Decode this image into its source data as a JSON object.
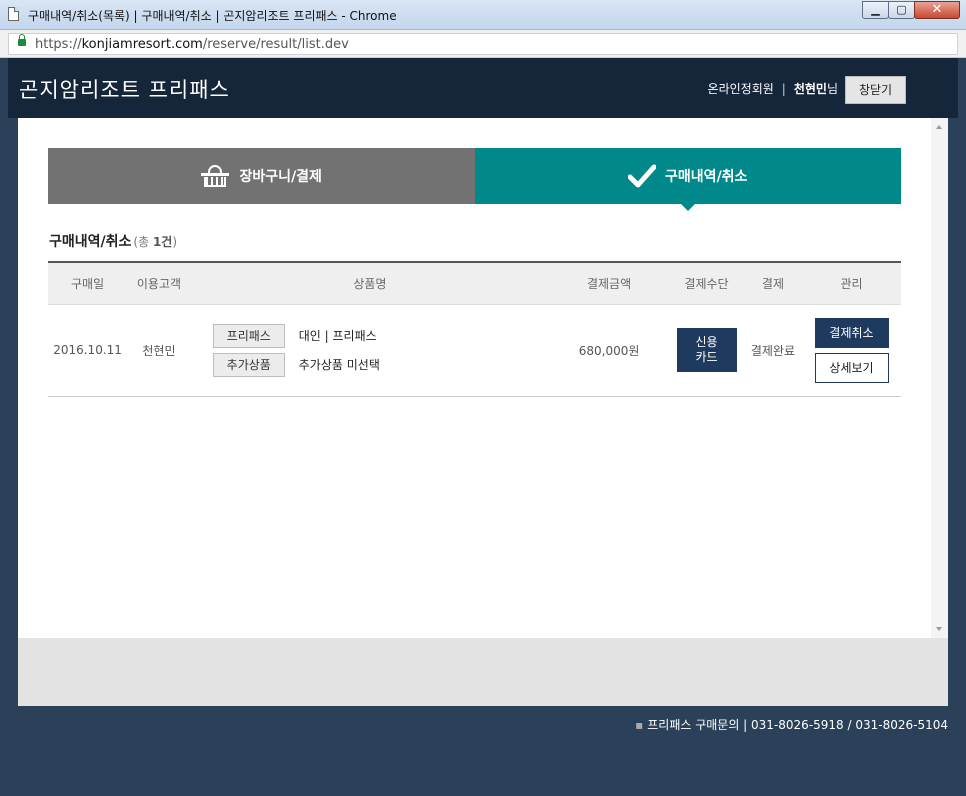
{
  "window": {
    "title": "구매내역/취소(목록) | 구매내역/취소 | 곤지암리조트 프리패스 - Chrome",
    "url_scheme": "https://",
    "url_host": "konjiamresort.com",
    "url_path": "/reserve/result/list.dev"
  },
  "header": {
    "site_title": "곤지암리조트 프리패스",
    "member_type": "온라인정회원",
    "user_name": "천현민",
    "user_suffix": "님",
    "close_label": "창닫기"
  },
  "tabs": [
    {
      "label": "장바구니/결제",
      "icon": "basket-icon",
      "active": false,
      "color": "#727272"
    },
    {
      "label": "구매내역/취소",
      "icon": "check-icon",
      "active": true,
      "color": "#00888a"
    }
  ],
  "section": {
    "title": "구매내역/취소",
    "count_prefix": "(총 ",
    "count_value": "1건",
    "count_suffix": ")"
  },
  "table": {
    "columns": [
      "구매일",
      "이용고객",
      "상품명",
      "결제금액",
      "결제수단",
      "결제",
      "관리"
    ],
    "rows": [
      {
        "date": "2016.10.11",
        "customer": "천현민",
        "products": [
          {
            "tag": "프리패스",
            "text": "대인 | 프리패스"
          },
          {
            "tag": "추가상품",
            "text": "추가상품 미선택"
          }
        ],
        "amount": "680,000원",
        "method_line1": "신용",
        "method_line2": "카드",
        "status": "결제완료",
        "cancel_label": "결제취소",
        "detail_label": "상세보기"
      }
    ]
  },
  "footer": {
    "text": "프리패스 구매문의 | 031-8026-5918 / 031-8026-5104"
  },
  "colors": {
    "header_bg": "#16263a",
    "accent_teal": "#00888a",
    "navy_button": "#1e3a5f"
  }
}
